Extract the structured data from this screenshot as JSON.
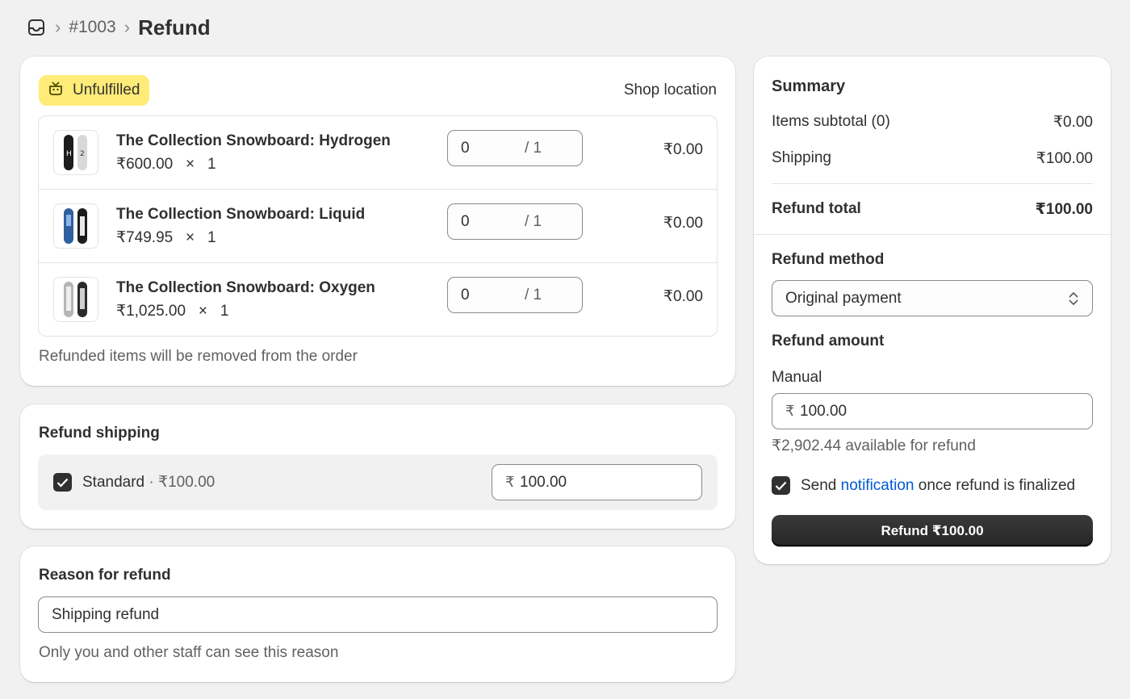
{
  "breadcrumb": {
    "icon": "inbox-icon",
    "order": "#1003",
    "title": "Refund"
  },
  "fulfillment": {
    "status": "Unfulfilled",
    "status_color": "#ffeb78",
    "location": "Shop location"
  },
  "items": [
    {
      "name": "The Collection Snowboard: Hydrogen",
      "price": "₹600.00",
      "times": "×",
      "qty_ordered": "1",
      "qty_refund": "0",
      "qty_max": "/ 1",
      "total": "₹0.00"
    },
    {
      "name": "The Collection Snowboard: Liquid",
      "price": "₹749.95",
      "times": "×",
      "qty_ordered": "1",
      "qty_refund": "0",
      "qty_max": "/ 1",
      "total": "₹0.00"
    },
    {
      "name": "The Collection Snowboard: Oxygen",
      "price": "₹1,025.00",
      "times": "×",
      "qty_ordered": "1",
      "qty_refund": "0",
      "qty_max": "/ 1",
      "total": "₹0.00"
    }
  ],
  "items_help": "Refunded items will be removed from the order",
  "shipping": {
    "title": "Refund shipping",
    "checked": true,
    "method": "Standard",
    "separator": "·",
    "method_price": "₹100.00",
    "currency": "₹",
    "amount": "100.00"
  },
  "reason": {
    "title": "Reason for refund",
    "value": "Shipping refund",
    "help": "Only you and other staff can see this reason"
  },
  "summary": {
    "title": "Summary",
    "subtotal_label": "Items subtotal (0)",
    "subtotal_value": "₹0.00",
    "shipping_label": "Shipping",
    "shipping_value": "₹100.00",
    "total_label": "Refund total",
    "total_value": "₹100.00",
    "method_title": "Refund method",
    "method_value": "Original payment",
    "amount_title": "Refund amount",
    "amount_field_label": "Manual",
    "amount_currency": "₹",
    "amount_value": "100.00",
    "available": "₹2,902.44 available for refund",
    "notify_checked": true,
    "notify_before": "Send ",
    "notify_link": "notification",
    "notify_after": " once refund is finalized",
    "link_color": "#005bd3",
    "button_label": "Refund ₹100.00"
  }
}
